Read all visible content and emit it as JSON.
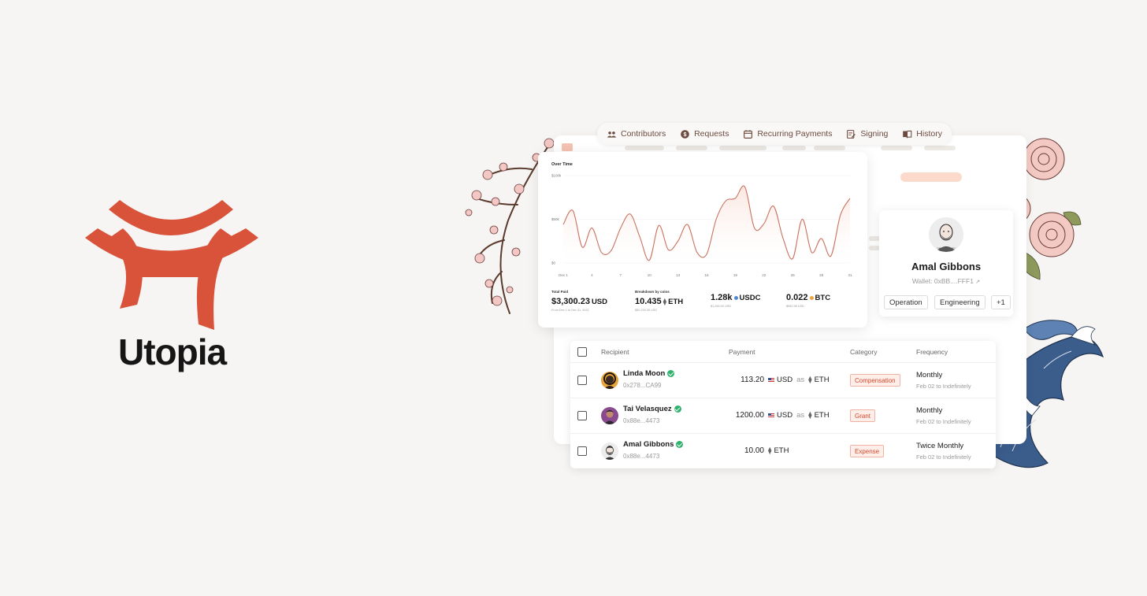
{
  "brand": {
    "name": "Utopia",
    "accent": "#d9533b"
  },
  "nav": {
    "items": [
      {
        "label": "Contributors",
        "icon": "people-icon"
      },
      {
        "label": "Requests",
        "icon": "dollar-circle-icon"
      },
      {
        "label": "Recurring Payments",
        "icon": "calendar-icon"
      },
      {
        "label": "Signing",
        "icon": "signature-icon"
      },
      {
        "label": "History",
        "icon": "book-icon"
      }
    ]
  },
  "chart": {
    "title": "Over Time",
    "stats": [
      {
        "label": "Total Paid",
        "value": "$3,300.23",
        "unit": "USD",
        "sub": "From Dec 1 to Dec 31, 2021"
      },
      {
        "label": "Breakdown by coins",
        "value": "10.435",
        "unit": "ETH",
        "coin": "eth",
        "sub": "$50,239.39 USD"
      },
      {
        "label": "",
        "value": "1.28k",
        "unit": "USDC",
        "coin": "usdc",
        "sub": "$1,284.00 USD"
      },
      {
        "label": "",
        "value": "0.022",
        "unit": "BTC",
        "coin": "btc",
        "sub": "$962.98 USD"
      }
    ]
  },
  "chart_data": {
    "type": "area",
    "title": "Over Time",
    "xlabel": "",
    "ylabel": "",
    "x_ticks": [
      "Dec 1",
      "4",
      "7",
      "10",
      "13",
      "16",
      "19",
      "22",
      "25",
      "28",
      "31"
    ],
    "y_ticks": [
      "$100k",
      "$50k",
      "$0"
    ],
    "ylim": [
      0,
      100000
    ],
    "x": [
      1,
      2,
      3,
      4,
      5,
      6,
      7,
      8,
      9,
      10,
      11,
      12,
      13,
      14,
      15,
      16,
      17,
      18,
      19,
      20,
      21,
      22,
      23,
      24,
      25,
      26,
      27,
      28,
      29,
      30,
      31
    ],
    "values": [
      44000,
      60000,
      18000,
      40000,
      12000,
      14000,
      40000,
      56000,
      30000,
      3000,
      43000,
      15000,
      25000,
      44000,
      12000,
      10000,
      50000,
      71000,
      74000,
      87000,
      40000,
      45000,
      65000,
      28000,
      5000,
      50000,
      12000,
      28000,
      8000,
      55000,
      74000
    ],
    "color": "#c9725f",
    "fill": "#fbe6df"
  },
  "profile": {
    "name": "Amal Gibbons",
    "wallet": "Wallet: 0xBB....FFF1",
    "tags": [
      "Operation",
      "Engineering",
      "+1"
    ]
  },
  "table": {
    "headers": {
      "recipient": "Recipient",
      "payment": "Payment",
      "category": "Category",
      "frequency": "Frequency"
    },
    "rows": [
      {
        "name": "Linda Moon",
        "address": "0x278...CA99",
        "amount": "113.20",
        "currency": "USD",
        "as": "as",
        "token": "ETH",
        "category": "Compensation",
        "frequency": "Monthly",
        "frequency_sub": "Feb 02 to Indefinitely"
      },
      {
        "name": "Tai Velasquez",
        "address": "0x88e...4473",
        "amount": "1200.00",
        "currency": "USD",
        "as": "as",
        "token": "ETH",
        "category": "Grant",
        "frequency": "Monthly",
        "frequency_sub": "Feb 02 to Indefinitely"
      },
      {
        "name": "Amal Gibbons",
        "address": "0x88e...4473",
        "amount": "10.00",
        "currency": "",
        "as": "",
        "token": "ETH",
        "category": "Expense",
        "frequency": "Twice Monthly",
        "frequency_sub": "Feb 02 to Indefinitely"
      }
    ]
  }
}
